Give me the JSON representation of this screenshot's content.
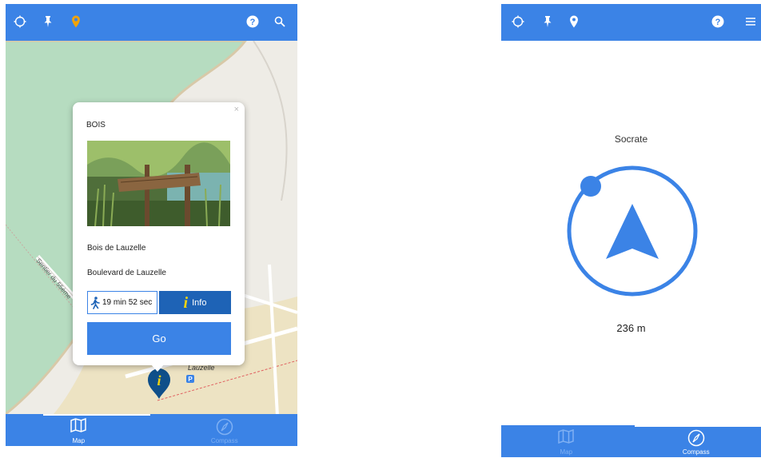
{
  "map_screen": {
    "tabs": [
      {
        "label": "Map",
        "icon": "map-icon",
        "active": true
      },
      {
        "label": "Compass",
        "icon": "compass-icon",
        "active": false
      }
    ],
    "map_labels": {
      "street": "Sentier du 55ème",
      "place": "Lauzelle",
      "parking": "P"
    },
    "popup": {
      "title": "BOIS",
      "name": "Bois de Lauzelle",
      "address": "Boulevard de Lauzelle",
      "walk_time": "19 min 52 sec",
      "info_label": "Info",
      "go_label": "Go",
      "close": "×",
      "info_glyph": "i"
    }
  },
  "compass_screen": {
    "target_name": "Socrate",
    "distance": "236 m",
    "tabs": [
      {
        "label": "Map",
        "icon": "map-icon",
        "active": false
      },
      {
        "label": "Compass",
        "icon": "compass-icon",
        "active": true
      }
    ]
  },
  "colors": {
    "primary": "#3b83e6",
    "dark_blue": "#1e63b6",
    "active_pin": "#f0a30a",
    "info_yellow": "#f4d40e"
  }
}
